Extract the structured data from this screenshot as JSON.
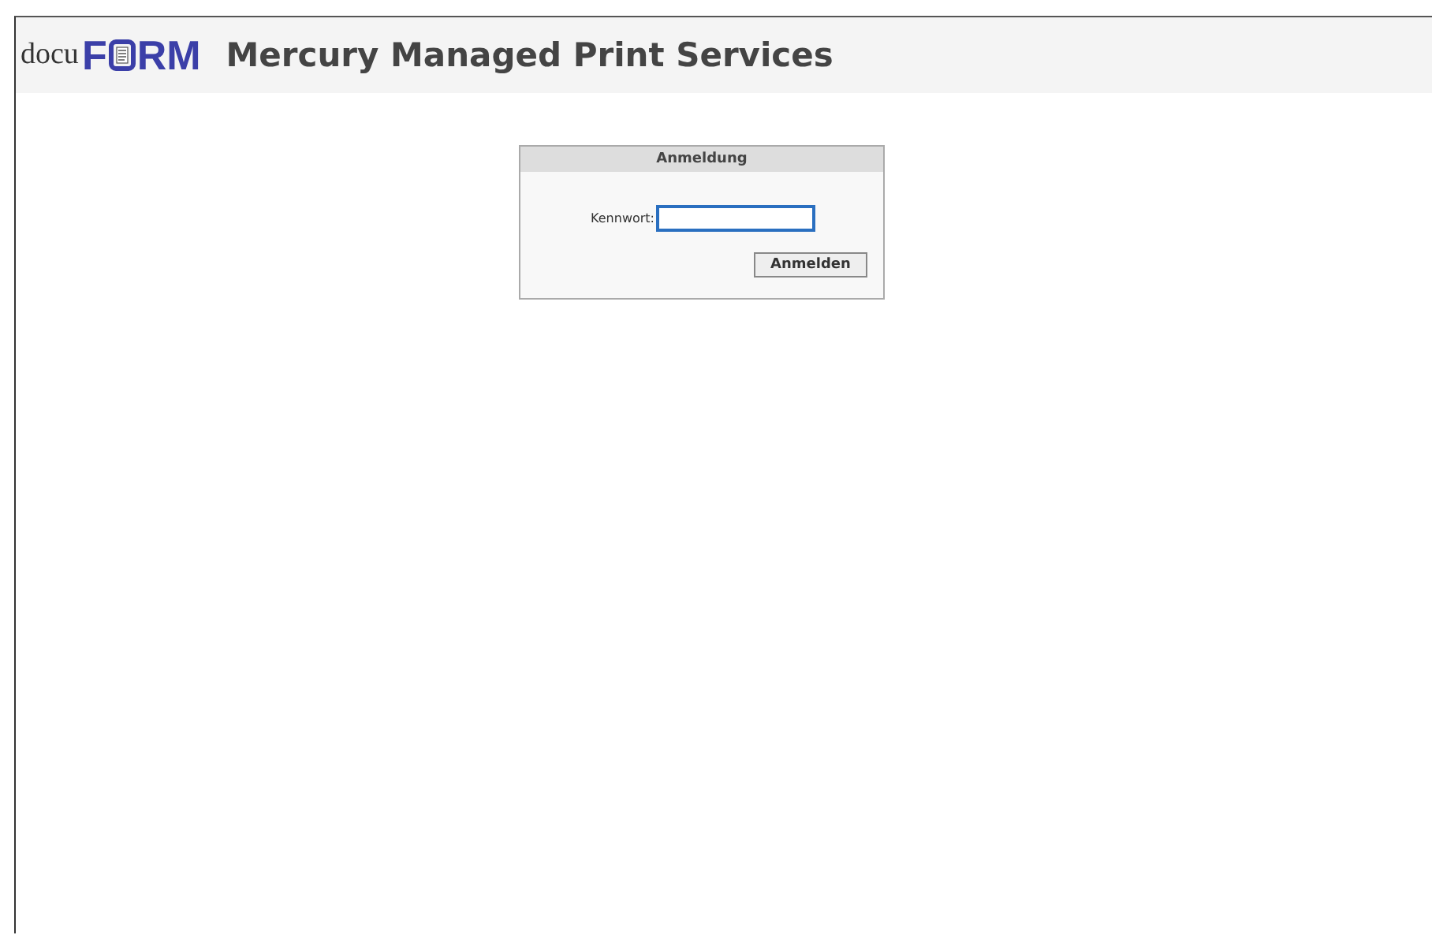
{
  "header": {
    "logo": {
      "prefix": "docu",
      "letter_1": "F",
      "letters_2": "RM"
    },
    "title": "Mercury Managed Print Services"
  },
  "login": {
    "title": "Anmeldung",
    "password_label": "Kennwort:",
    "password_focused": true,
    "button": "Anmelden"
  }
}
